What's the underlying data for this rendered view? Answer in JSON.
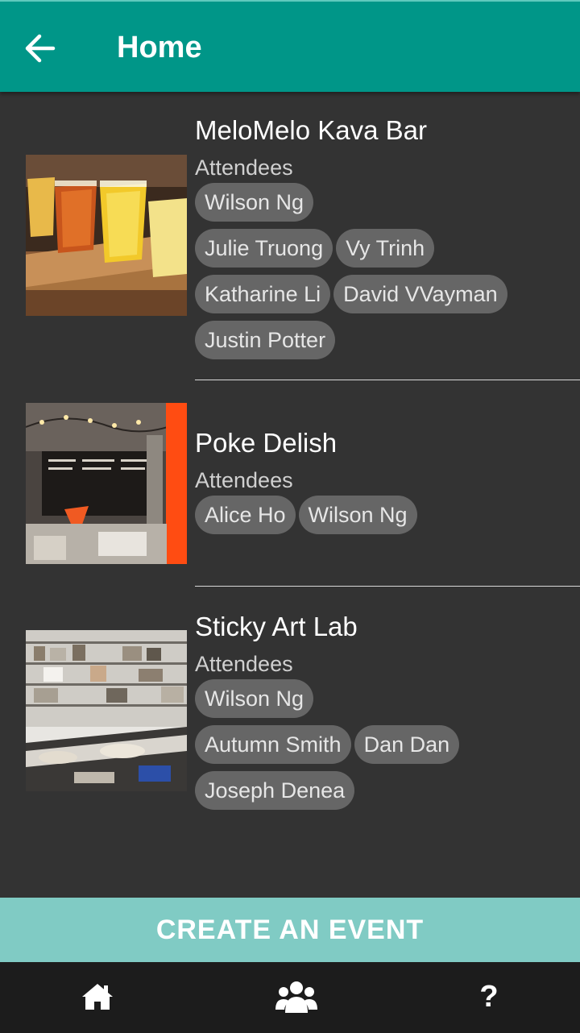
{
  "header": {
    "title": "Home"
  },
  "events": [
    {
      "name": "MeloMelo Kava Bar",
      "attendees_label": "Attendees",
      "attendees": [
        "Wilson Ng",
        "Julie Truong",
        "Vy Trinh",
        "Katharine Li",
        "David VVayman",
        "Justin Potter"
      ]
    },
    {
      "name": "Poke Delish",
      "attendees_label": "Attendees",
      "attendees": [
        "Alice Ho",
        "Wilson Ng"
      ]
    },
    {
      "name": "Sticky Art Lab",
      "attendees_label": "Attendees",
      "attendees": [
        "Wilson Ng",
        "Autumn Smith",
        "Dan Dan",
        "Joseph Denea"
      ]
    }
  ],
  "create_button": {
    "label": "CREATE AN EVENT"
  },
  "bottom_nav": {
    "items": [
      {
        "icon": "home-icon"
      },
      {
        "icon": "group-icon"
      },
      {
        "icon": "help-icon",
        "glyph": "?"
      }
    ]
  },
  "colors": {
    "header": "#009688",
    "background": "#333333",
    "chip": "#666666",
    "create_button": "#80cbc4",
    "bottom_nav": "#1c1c1c"
  }
}
